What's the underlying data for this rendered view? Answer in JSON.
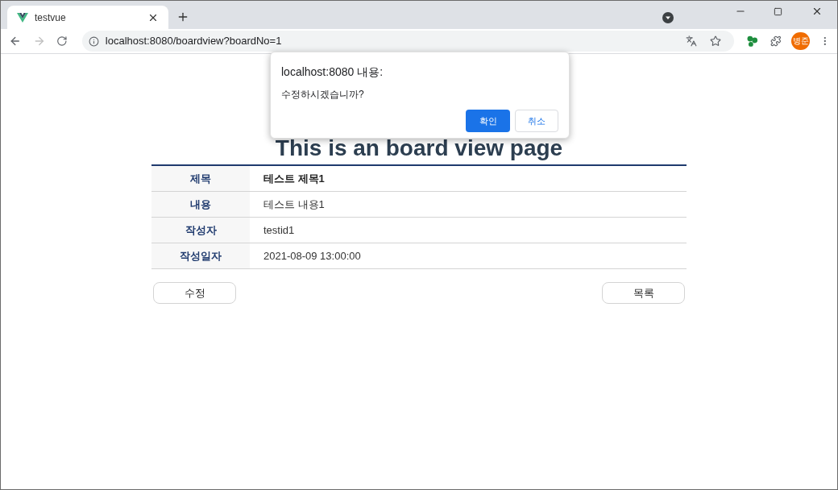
{
  "browser": {
    "tab": {
      "title": "testvue",
      "selected": true
    },
    "address": "localhost:8080/boardview?boardNo=1",
    "profile": "병준"
  },
  "page": {
    "heading": "This is an board view page",
    "rows": [
      {
        "label": "제목",
        "value": "테스트 제목1",
        "emphasis": true
      },
      {
        "label": "내용",
        "value": "테스트 내용1",
        "emphasis": false
      },
      {
        "label": "작성자",
        "value": "testid1",
        "emphasis": false
      },
      {
        "label": "작성일자",
        "value": "2021-08-09 13:00:00",
        "emphasis": false
      }
    ],
    "buttons": [
      "수정",
      "목록"
    ]
  },
  "dialog": {
    "title": "localhost:8080 내용:",
    "message": "수정하시겠습니까?",
    "ok": "확인",
    "cancel": "취소"
  }
}
